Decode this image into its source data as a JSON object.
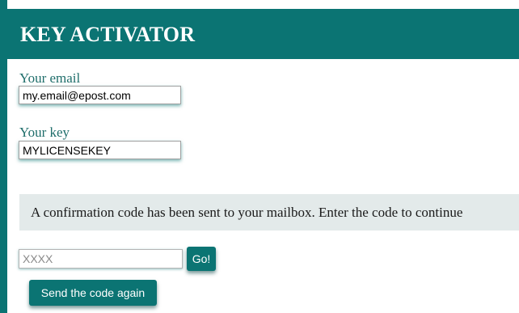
{
  "header": {
    "title": "KEY ACTIVATOR"
  },
  "form": {
    "email_label": "Your email",
    "email_value": "my.email@epost.com",
    "key_label": "Your key",
    "key_value": "MYLICENSEKEY"
  },
  "confirmation": {
    "message": "A confirmation code has been sent to your mailbox. Enter the code to continue",
    "code_placeholder": "XXXX",
    "code_value": "",
    "go_label": "Go!",
    "resend_label": "Send the code again"
  },
  "colors": {
    "accent": "#0b7473",
    "label_text": "#1f6e6b",
    "message_background": "#e3eaea"
  }
}
